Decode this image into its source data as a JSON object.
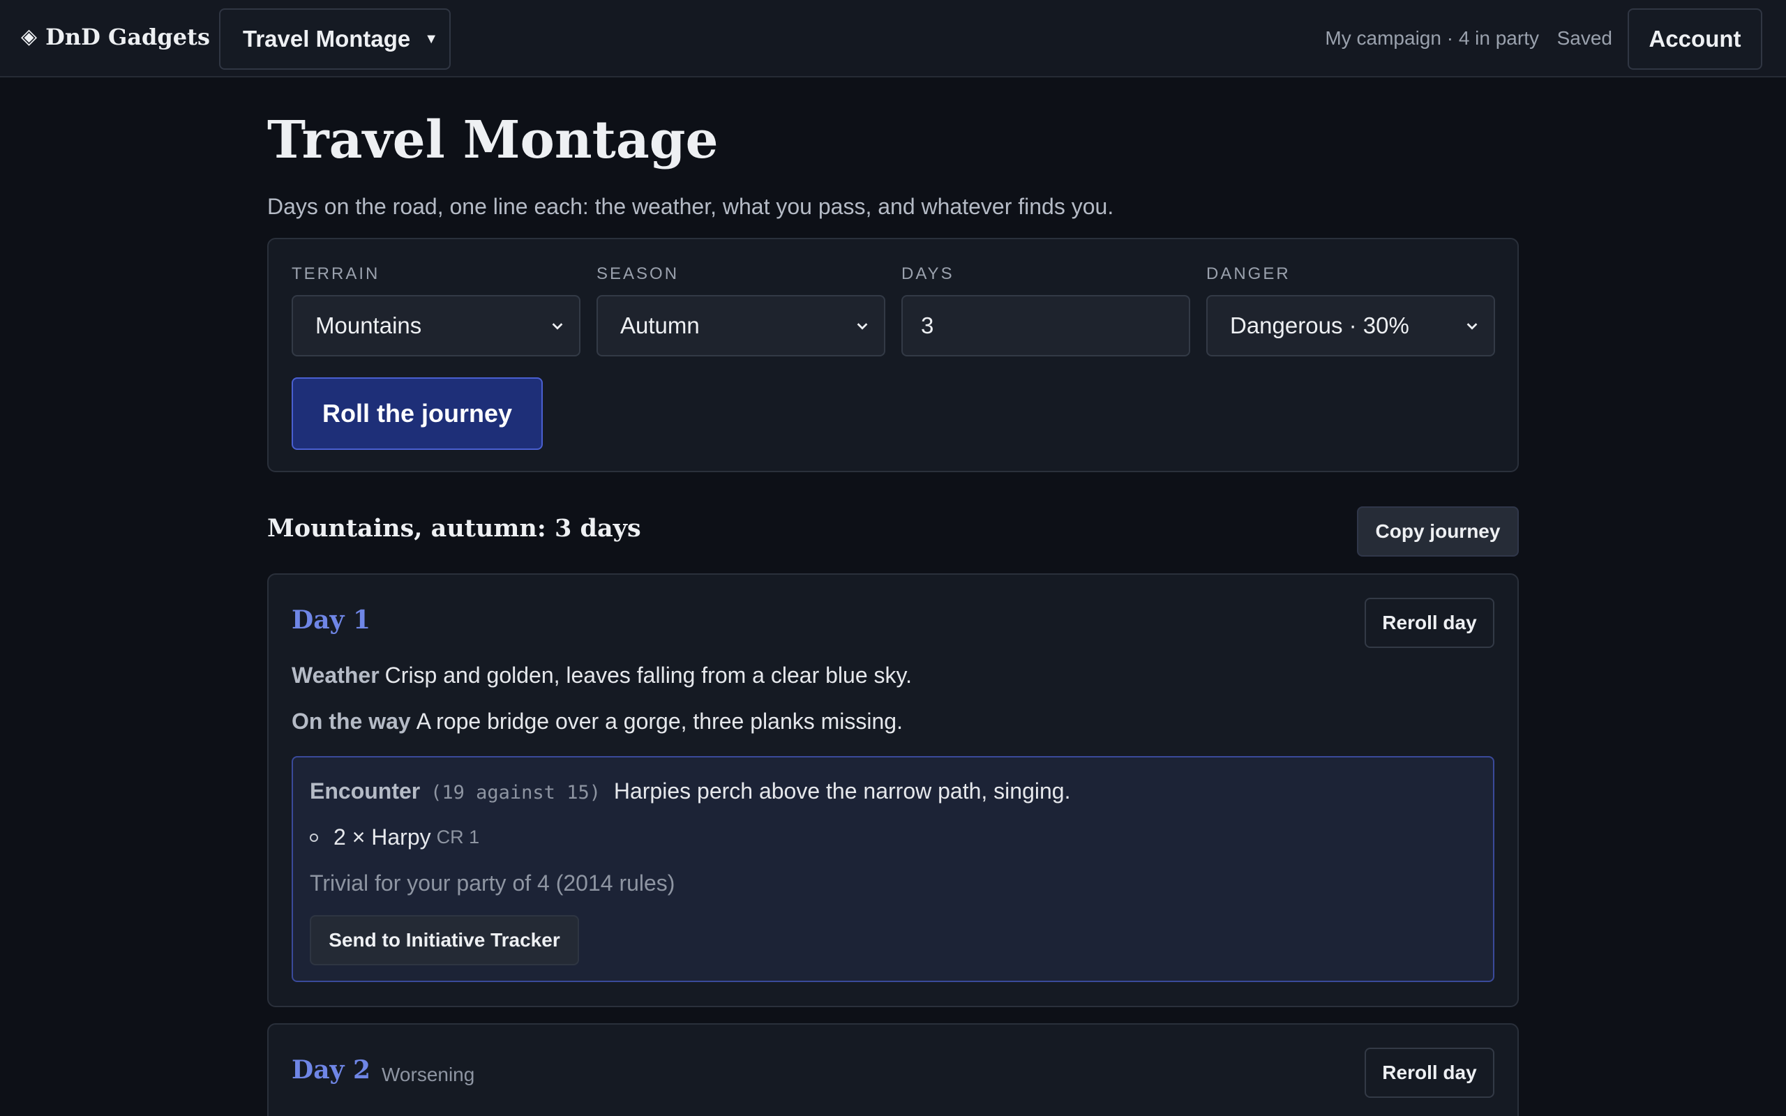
{
  "header": {
    "brand_icon": "diamond-icon",
    "brand": "DnD Gadgets",
    "tool_switcher": "Travel Montage",
    "campaign": "My campaign · 4 in party",
    "save_status": "Saved",
    "account": "Account"
  },
  "page": {
    "title": "Travel Montage",
    "subtitle": "Days on the road, one line each: the weather, what you pass, and whatever finds you."
  },
  "form": {
    "terrain": {
      "label": "TERRAIN",
      "value": "Mountains"
    },
    "season": {
      "label": "SEASON",
      "value": "Autumn"
    },
    "days": {
      "label": "DAYS",
      "value": "3"
    },
    "danger": {
      "label": "DANGER",
      "value": "Dangerous · 30%"
    },
    "roll_button": "Roll the journey"
  },
  "result": {
    "heading": "Mountains, autumn: 3 days",
    "copy_button": "Copy journey",
    "days": [
      {
        "title": "Day 1",
        "reroll": "Reroll day",
        "weather_label": "Weather",
        "weather": "Crisp and golden, leaves falling from a clear blue sky.",
        "way_label": "On the way",
        "way": "A rope bridge over a gorge, three planks missing.",
        "encounter": {
          "label": "Encounter",
          "roll": "(19 against 15)",
          "text": "Harpies perch above the narrow path, singing.",
          "monster": "2 × Harpy",
          "cr": "CR 1",
          "difficulty": "Trivial for your party of 4 (2014 rules)",
          "send_button": "Send to Initiative Tracker"
        }
      },
      {
        "title": "Day 2",
        "tag": "Worsening",
        "reroll": "Reroll day"
      }
    ]
  },
  "colors": {
    "background": "#0d1017",
    "accent": "#6f86e6",
    "primary_button": "#1e2f78"
  }
}
